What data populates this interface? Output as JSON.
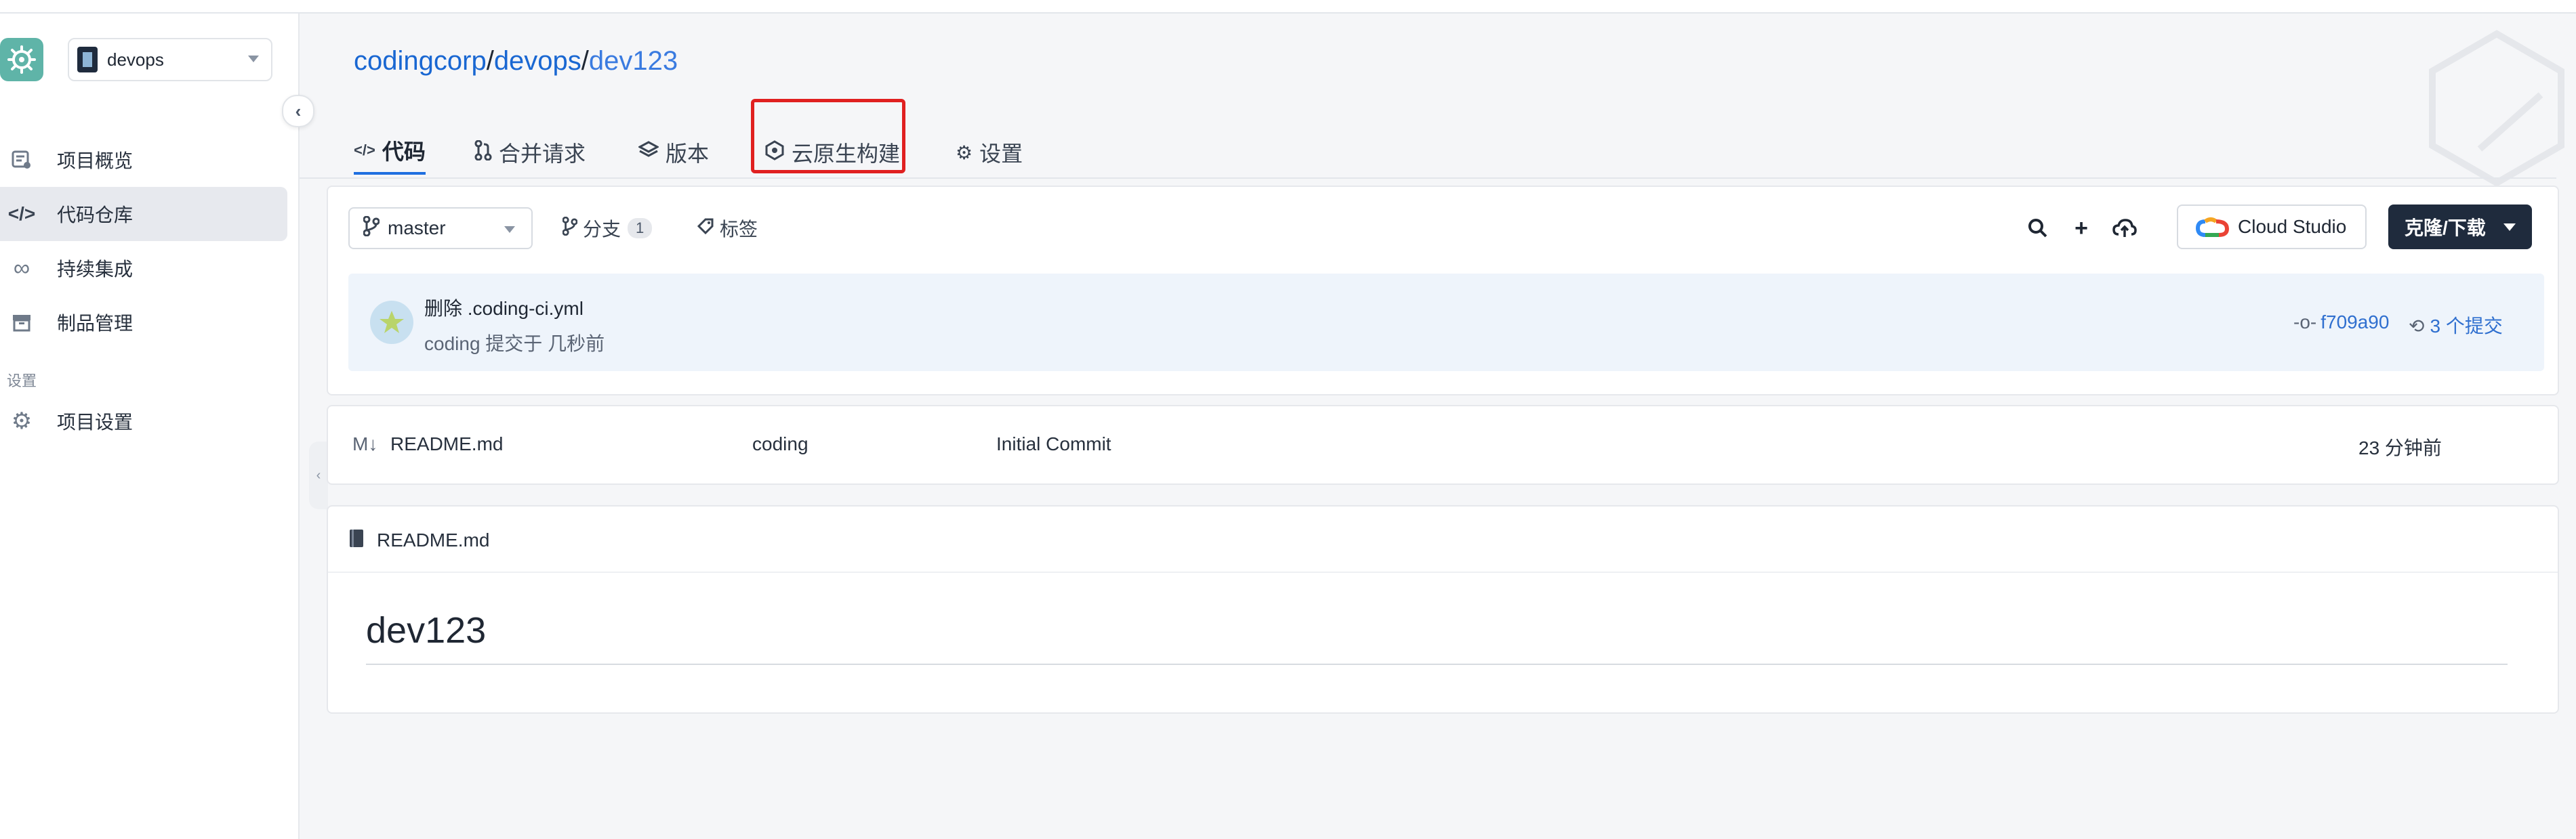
{
  "sidebar": {
    "project_name": "devops",
    "items": [
      {
        "label": "项目概览",
        "icon": "overview-icon"
      },
      {
        "label": "代码仓库",
        "icon": "code-icon"
      },
      {
        "label": "持续集成",
        "icon": "infinity-icon"
      },
      {
        "label": "制品管理",
        "icon": "package-icon"
      }
    ],
    "section_label": "设置",
    "settings_item": {
      "label": "项目设置",
      "icon": "gear-icon"
    }
  },
  "breadcrumb": {
    "org": "codingcorp",
    "sep1": "/",
    "project": "devops",
    "sep2": "/",
    "repo": "dev123"
  },
  "tabs": [
    {
      "label": "代码",
      "icon": "code-icon",
      "active": true
    },
    {
      "label": "合并请求",
      "icon": "merge-request-icon"
    },
    {
      "label": "版本",
      "icon": "layers-icon"
    },
    {
      "label": "云原生构建",
      "icon": "build-icon"
    },
    {
      "label": "设置",
      "icon": "gear-icon"
    }
  ],
  "toolbar": {
    "branch": "master",
    "branches_label": "分支",
    "branches_count": "1",
    "tags_label": "标签",
    "cloud_studio_label": "Cloud Studio",
    "clone_label": "克隆/下载"
  },
  "last_commit": {
    "message": "删除 .coding-ci.yml",
    "meta": "coding  提交于 几秒前",
    "hash": "f709a90",
    "commits": "3 个提交"
  },
  "files": [
    {
      "name": "README.md",
      "author": "coding",
      "message": "Initial Commit",
      "time": "23 分钟前",
      "icon": "markdown-icon"
    }
  ],
  "readme": {
    "file_name": "README.md",
    "heading": "dev123"
  },
  "colors": {
    "accent": "#1967d2",
    "highlight_box": "#e02020",
    "clone_button": "#1f2b3d"
  }
}
